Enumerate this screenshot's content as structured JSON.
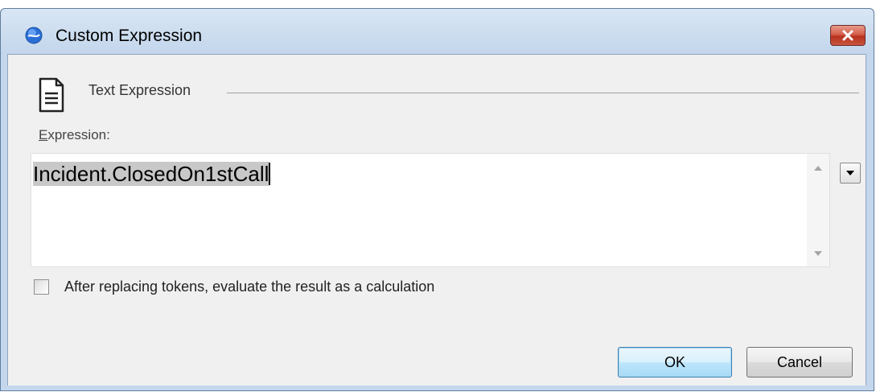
{
  "window": {
    "title": "Custom Expression",
    "icon": "app-globe-icon",
    "close_icon": "close-icon",
    "accent": "#c4d7ed"
  },
  "section": {
    "icon": "document-icon",
    "title": "Text Expression"
  },
  "expression": {
    "label_accel": "E",
    "label_rest": "xpression:",
    "value": "Incident.ClosedOn1stCall",
    "scroll_up_icon": "scroll-up-arrow-icon",
    "scroll_down_icon": "scroll-down-arrow-icon",
    "dropdown_icon": "chevron-down-icon"
  },
  "options": {
    "evaluate_label": "After replacing tokens, evaluate the result as a calculation",
    "evaluate_checked": false
  },
  "buttons": {
    "ok_label": "OK",
    "cancel_label": "Cancel"
  }
}
